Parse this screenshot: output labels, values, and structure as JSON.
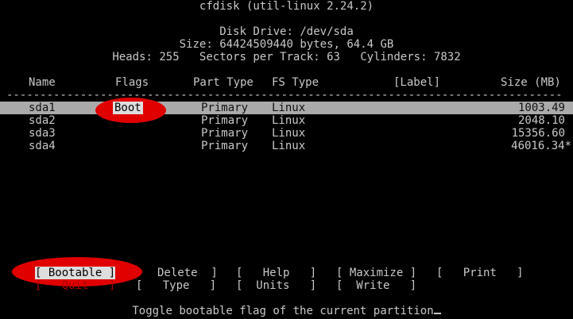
{
  "title": "cfdisk (util-linux 2.24.2)",
  "disk": {
    "drive_line": "Disk Drive: /dev/sda",
    "size_line": "Size: 64424509440 bytes, 64.4 GB",
    "geometry_line": "Heads: 255   Sectors per Track: 63   Cylinders: 7832"
  },
  "columns": {
    "name": "Name",
    "flags": "Flags",
    "part_type": "Part Type",
    "fs_type": "FS Type",
    "label": "[Label]",
    "size": "Size (MB)"
  },
  "separator": "-----------------------------------------------------------------------------------------------------",
  "partitions": [
    {
      "name": "sda1",
      "flags": "Boot",
      "part_type": "Primary",
      "fs_type": "Linux",
      "label": "",
      "size": "1003.49",
      "selected": true
    },
    {
      "name": "sda2",
      "flags": "",
      "part_type": "Primary",
      "fs_type": "Linux",
      "label": "",
      "size": "2048.10",
      "selected": false
    },
    {
      "name": "sda3",
      "flags": "",
      "part_type": "Primary",
      "fs_type": "Linux",
      "label": "",
      "size": "15356.60",
      "selected": false
    },
    {
      "name": "sda4",
      "flags": "",
      "part_type": "Primary",
      "fs_type": "Linux",
      "label": "",
      "size": "46016.34*",
      "selected": false
    }
  ],
  "menu": {
    "row1": {
      "bootable": "[ Bootable ]",
      "delete": "Delete  ]",
      "help": "[   Help   ]",
      "maximize": "[ Maximize ]",
      "print": "[   Print   ]"
    },
    "row2": {
      "quit": "[   Quit   ]",
      "type": "[   Type   ]",
      "units": "[  Units   ]",
      "write": "[  Write   ]"
    }
  },
  "status": "Toggle bootable flag of the current partition",
  "colors": {
    "highlight_oval": "#e00000",
    "selection_bar": "#aaaaaa",
    "text": "#c8c8c8"
  }
}
